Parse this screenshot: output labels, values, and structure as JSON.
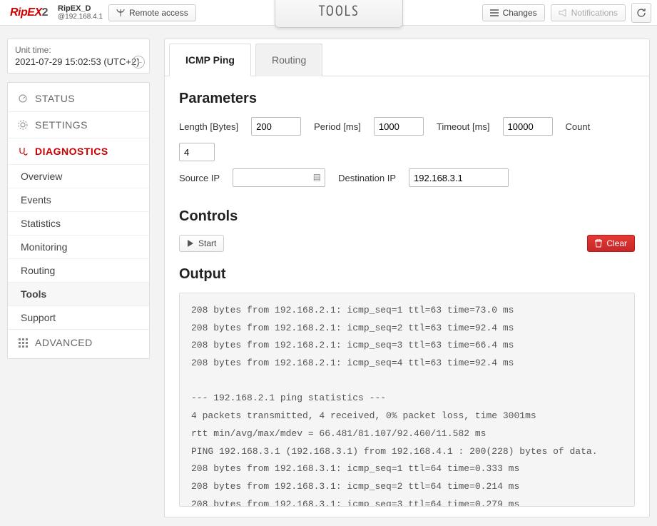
{
  "header": {
    "logo_main": "RipEX",
    "logo_suffix": "2",
    "device_name": "RipEX_D",
    "device_ip": "@192.168.4.1",
    "remote_access": "Remote access",
    "tools_title": "TOOLS",
    "changes": "Changes",
    "notifications": "Notifications"
  },
  "unit_time": {
    "label": "Unit time:",
    "value": "2021-07-29 15:02:53 (UTC+2)"
  },
  "nav": {
    "status": "STATUS",
    "settings": "SETTINGS",
    "diagnostics": "DIAGNOSTICS",
    "diag_items": [
      "Overview",
      "Events",
      "Statistics",
      "Monitoring",
      "Routing",
      "Tools",
      "Support"
    ],
    "advanced": "ADVANCED"
  },
  "tabs": {
    "icmp_ping": "ICMP Ping",
    "routing": "Routing"
  },
  "parameters": {
    "title": "Parameters",
    "length_label": "Length [Bytes]",
    "length_value": "200",
    "period_label": "Period [ms]",
    "period_value": "1000",
    "timeout_label": "Timeout [ms]",
    "timeout_value": "10000",
    "count_label": "Count",
    "count_value": "4",
    "source_ip_label": "Source IP",
    "source_ip_value": "",
    "dest_ip_label": "Destination IP",
    "dest_ip_value": "192.168.3.1"
  },
  "controls": {
    "title": "Controls",
    "start": "Start",
    "clear": "Clear"
  },
  "output": {
    "title": "Output",
    "text": "208 bytes from 192.168.2.1: icmp_seq=1 ttl=63 time=73.0 ms\n208 bytes from 192.168.2.1: icmp_seq=2 ttl=63 time=92.4 ms\n208 bytes from 192.168.2.1: icmp_seq=3 ttl=63 time=66.4 ms\n208 bytes from 192.168.2.1: icmp_seq=4 ttl=63 time=92.4 ms\n\n--- 192.168.2.1 ping statistics ---\n4 packets transmitted, 4 received, 0% packet loss, time 3001ms\nrtt min/avg/max/mdev = 66.481/81.107/92.460/11.582 ms\nPING 192.168.3.1 (192.168.3.1) from 192.168.4.1 : 200(228) bytes of data.\n208 bytes from 192.168.3.1: icmp_seq=1 ttl=64 time=0.333 ms\n208 bytes from 192.168.3.1: icmp_seq=2 ttl=64 time=0.214 ms\n208 bytes from 192.168.3.1: icmp_seq=3 ttl=64 time=0.279 ms"
  }
}
